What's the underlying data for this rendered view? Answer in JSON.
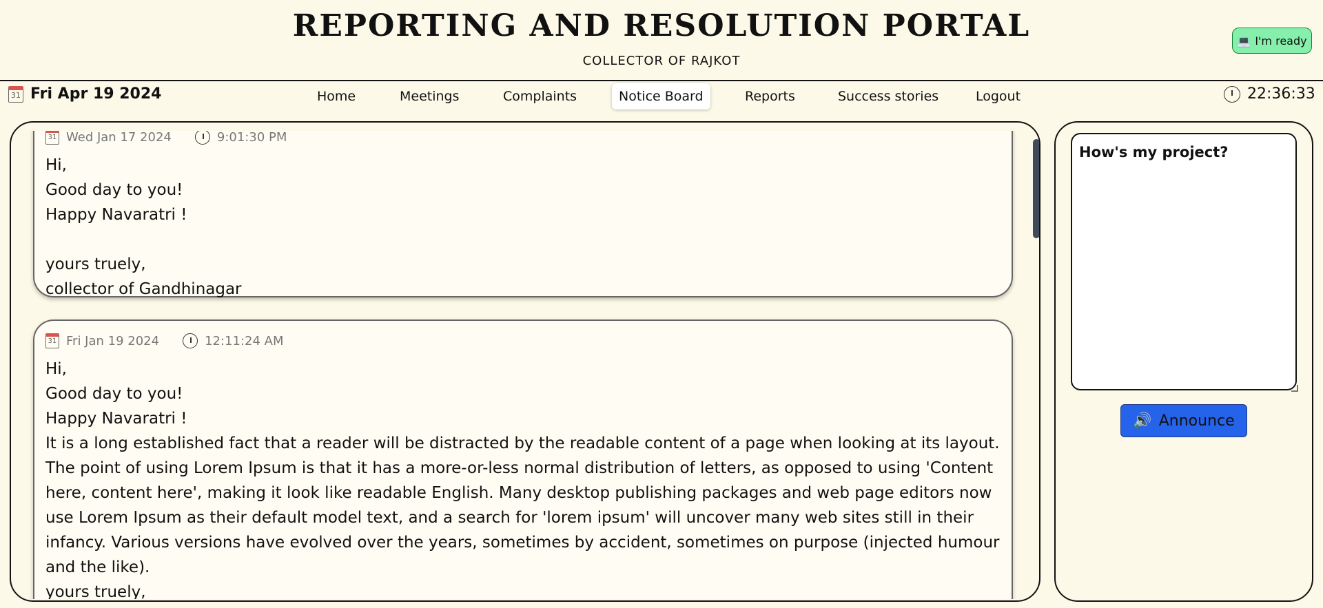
{
  "header": {
    "title": "REPORTING AND RESOLUTION PORTAL",
    "subtitle": "COLLECTOR OF RAJKOT",
    "ready_button": "I'm ready",
    "ready_icon": "laptop-icon"
  },
  "navbar": {
    "date": "Fri Apr 19 2024",
    "time": "22:36:33",
    "items": [
      {
        "label": "Home"
      },
      {
        "label": "Meetings"
      },
      {
        "label": "Complaints"
      },
      {
        "label": "Notice Board",
        "active": true
      },
      {
        "label": "Reports"
      },
      {
        "label": "Success stories"
      },
      {
        "label": "Logout"
      }
    ]
  },
  "calendar_icon_day": "31",
  "notices": [
    {
      "date": "Wed Jan 17 2024",
      "time": "9:01:30 PM",
      "body": "Hi,\nGood day to you!\nHappy Navaratri !\n\nyours truely,\ncollector of Gandhinagar"
    },
    {
      "date": "Fri Jan 19 2024",
      "time": "12:11:24 AM",
      "body": "Hi,\nGood day to you!\nHappy Navaratri !\nIt is a long established fact that a reader will be distracted by the readable content of a page when looking at its layout. The point of using Lorem Ipsum is that it has a more-or-less normal distribution of letters, as opposed to using 'Content here, content here', making it look like readable English. Many desktop publishing packages and web page editors now use Lorem Ipsum as their default model text, and a search for 'lorem ipsum' will uncover many web sites still in their infancy. Various versions have evolved over the years, sometimes by accident, sometimes on purpose (injected humour and the like).\nyours truely,"
    }
  ],
  "side_panel": {
    "textarea_value": "How's my project?",
    "announce_label": "Announce"
  },
  "colors": {
    "background": "#fdf9e8",
    "ready_button": "#86efac",
    "announce_button": "#2563eb",
    "active_tab": "#ffffff"
  }
}
